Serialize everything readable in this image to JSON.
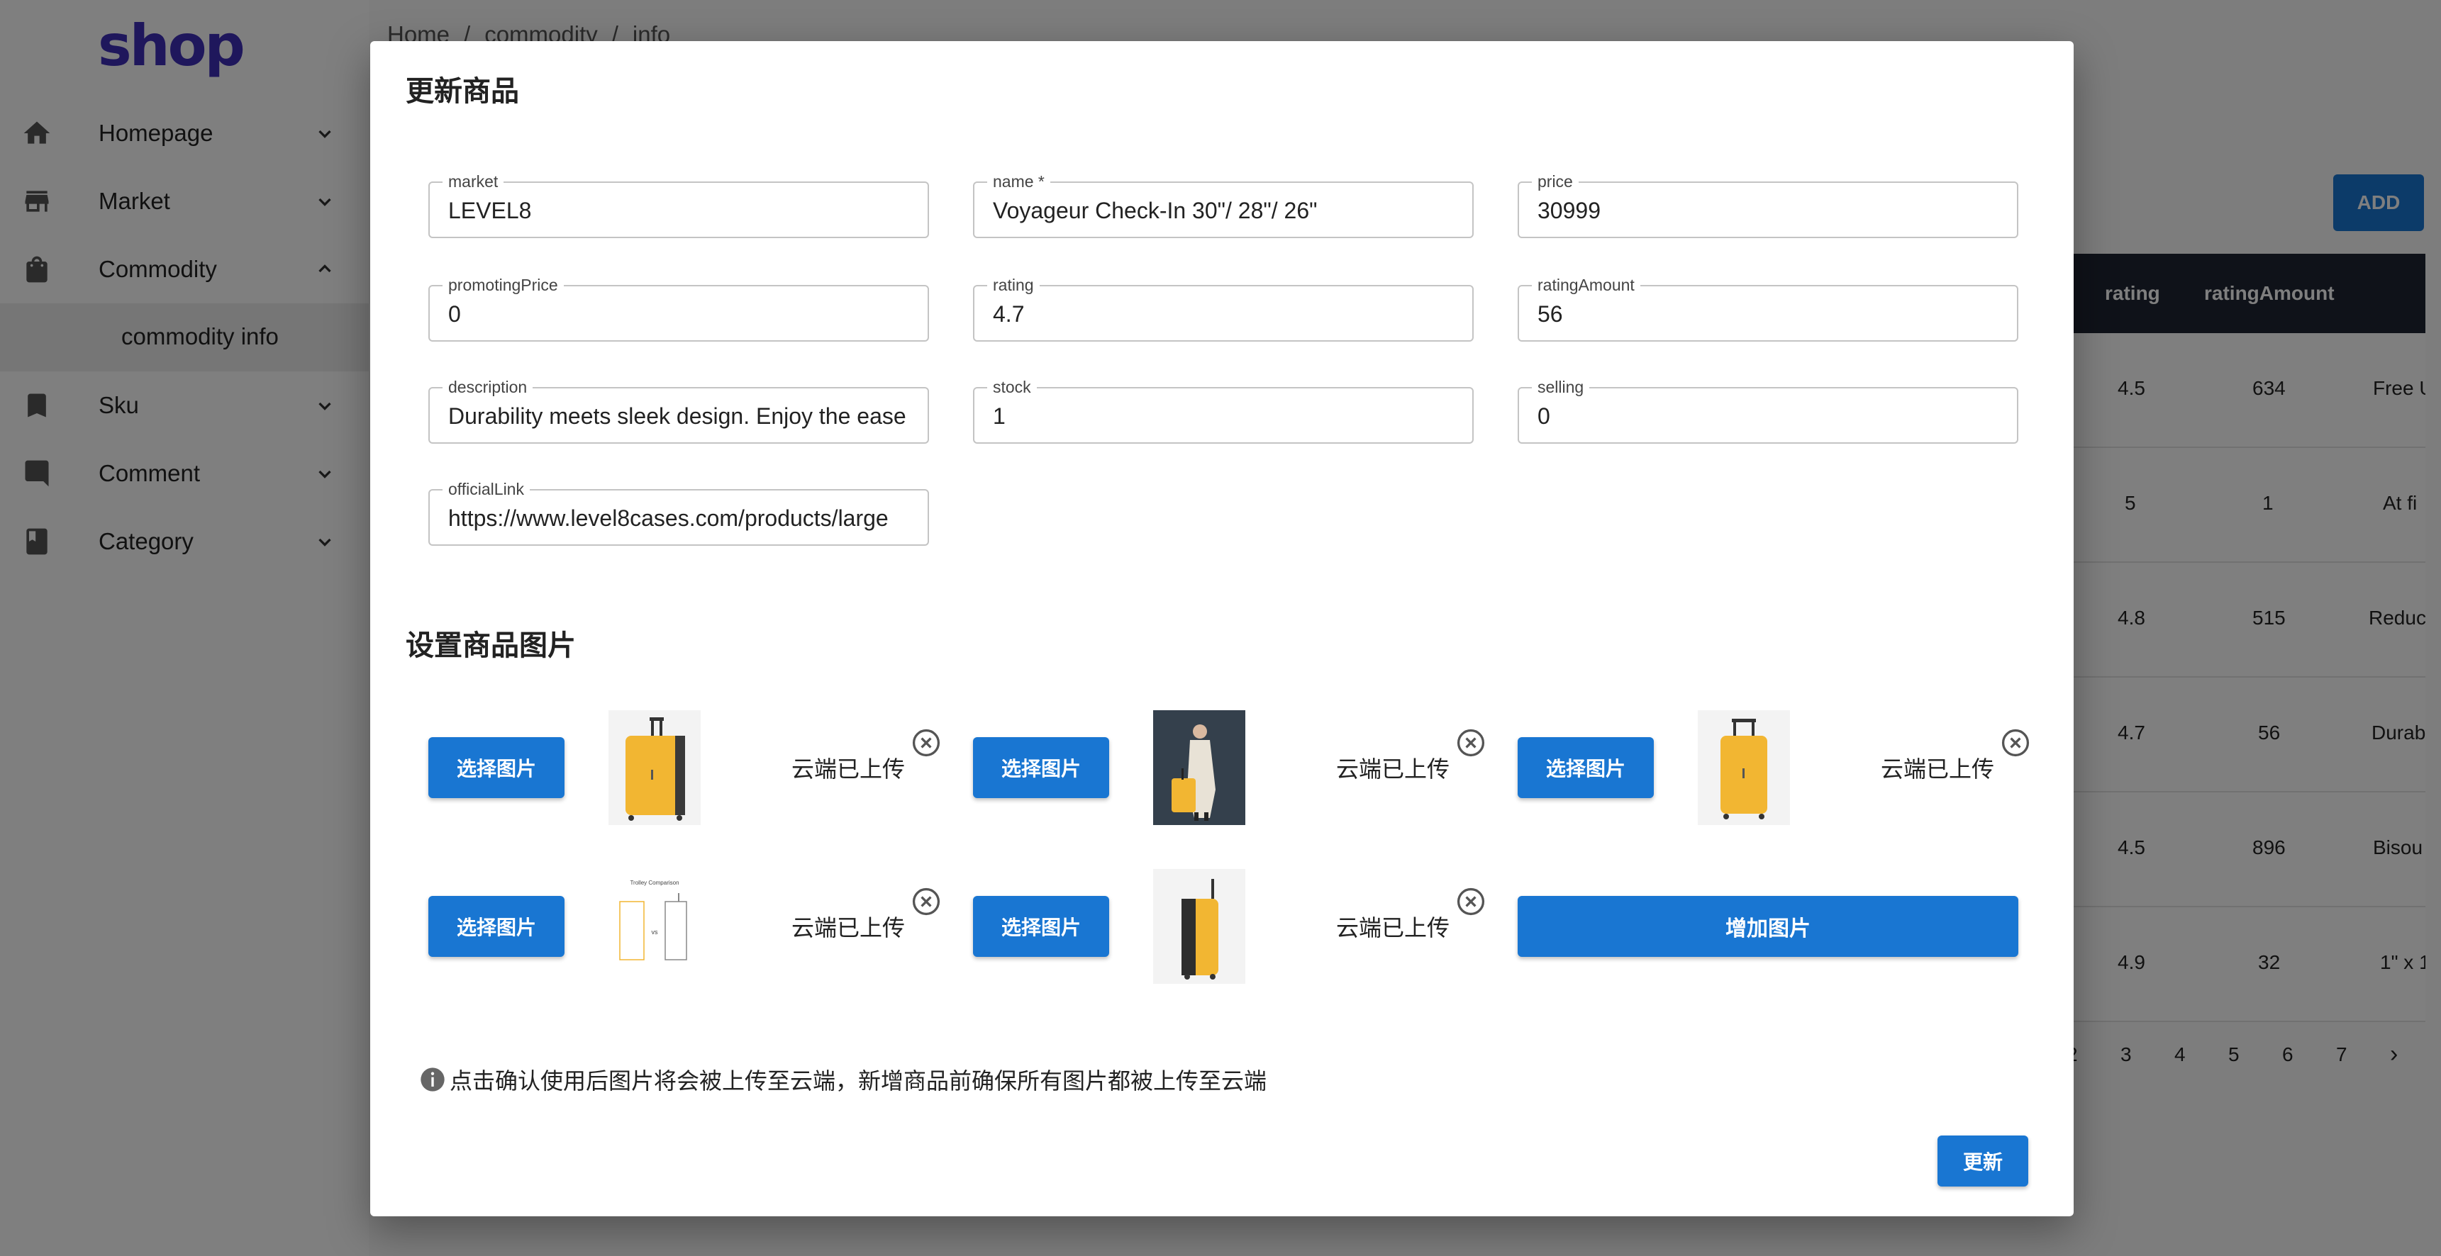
{
  "app": {
    "logo": "shop",
    "breadcrumb": [
      "Home",
      "/",
      "commodity",
      "/",
      "info"
    ],
    "sidebar": {
      "items": [
        {
          "label": "Homepage",
          "icon": "home-icon"
        },
        {
          "label": "Market",
          "icon": "store-icon"
        },
        {
          "label": "Commodity",
          "icon": "shopping-bag-icon",
          "expanded": true
        },
        {
          "label": "Sku",
          "icon": "bookmark-icon"
        },
        {
          "label": "Comment",
          "icon": "comment-icon"
        },
        {
          "label": "Category",
          "icon": "book-icon"
        }
      ],
      "subitem": "commodity info"
    },
    "add_button": "ADD",
    "table": {
      "headers": [
        "rating",
        "ratingAmount"
      ],
      "rows": [
        {
          "rating": "4.5",
          "ratingAmount": "634",
          "extra": "Free U"
        },
        {
          "rating": "5",
          "ratingAmount": "1",
          "extra": "At fi"
        },
        {
          "rating": "4.8",
          "ratingAmount": "515",
          "extra": "Reduc"
        },
        {
          "rating": "4.7",
          "ratingAmount": "56",
          "extra": "Durab"
        },
        {
          "rating": "4.5",
          "ratingAmount": "896",
          "extra": "Bisou"
        },
        {
          "rating": "4.9",
          "ratingAmount": "32",
          "extra": "1\" x 1"
        }
      ]
    },
    "pagination": [
      "2",
      "3",
      "4",
      "5",
      "6",
      "7",
      "›"
    ]
  },
  "modal": {
    "title": "更新商品",
    "fields": {
      "market": {
        "label": "market",
        "value": "LEVEL8"
      },
      "name": {
        "label": "name *",
        "value": "Voyageur Check-In 30\"/ 28\"/ 26\""
      },
      "price": {
        "label": "price",
        "value": "30999"
      },
      "promotingPrice": {
        "label": "promotingPrice",
        "value": "0"
      },
      "rating": {
        "label": "rating",
        "value": "4.7"
      },
      "ratingAmount": {
        "label": "ratingAmount",
        "value": "56"
      },
      "description": {
        "label": "description",
        "value": "Durability meets sleek design. Enjoy the ease"
      },
      "stock": {
        "label": "stock",
        "value": "1"
      },
      "selling": {
        "label": "selling",
        "value": "0"
      },
      "officialLink": {
        "label": "officialLink",
        "value": "https://www.level8cases.com/products/large"
      }
    },
    "images_section_title": "设置商品图片",
    "choose_label": "选择图片",
    "uploaded_status": "云端已上传",
    "images": [
      {
        "thumb": "yellow-suitcase"
      },
      {
        "thumb": "person-with-suitcase"
      },
      {
        "thumb": "yellow-suitcase-front"
      },
      {
        "thumb": "trolley-comparison-diagram",
        "caption": "Trolley Comparison",
        "vs": "vs"
      },
      {
        "thumb": "black-yellow-suitcase-side"
      }
    ],
    "add_image_label": "增加图片",
    "notice": "点击确认使用后图片将会被上传至云端，新增商品前确保所有图片都被上传至云端",
    "submit_label": "更新"
  }
}
